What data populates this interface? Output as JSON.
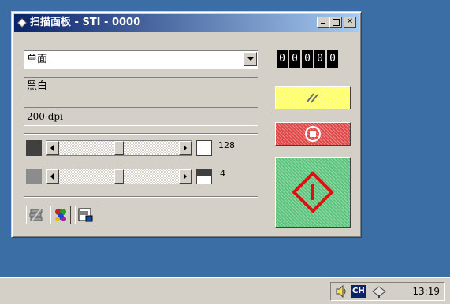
{
  "window": {
    "title": "扫描面板 - STI - 0000",
    "controls": [
      "minimize",
      "maximize",
      "close"
    ]
  },
  "scan_mode": {
    "selected": "单面"
  },
  "color_mode": {
    "value": "黑白"
  },
  "resolution": {
    "value": "200 dpi"
  },
  "counter": {
    "digits": [
      "0",
      "0",
      "0",
      "0",
      "0"
    ]
  },
  "brightness": {
    "value": "128",
    "level": 128,
    "max": 255
  },
  "contrast": {
    "value": "4",
    "level": 4,
    "max": 8
  },
  "buttons": {
    "reset": {
      "icon": "reset-icon",
      "color": "#ffff66"
    },
    "stop": {
      "icon": "stop-icon",
      "color": "#e04848"
    },
    "start": {
      "icon": "start-icon",
      "color": "#5cc47c"
    }
  },
  "toolbar": [
    "scan-settings-icon",
    "color-palette-icon",
    "preview-icon"
  ],
  "taskbar": {
    "language": "CH",
    "clock": "13:19"
  }
}
